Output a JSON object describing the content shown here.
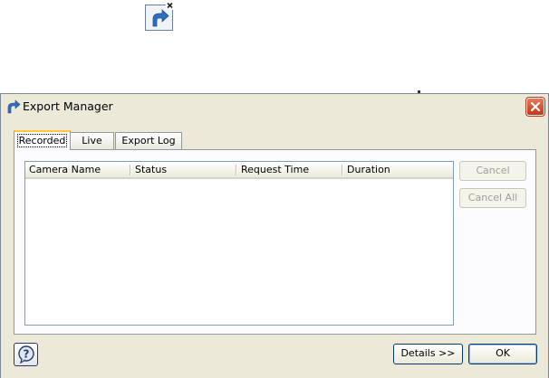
{
  "window": {
    "title": "Export Manager"
  },
  "tabs": [
    {
      "label": "Recorded",
      "active": true
    },
    {
      "label": "Live",
      "active": false
    },
    {
      "label": "Export Log",
      "active": false
    }
  ],
  "table": {
    "columns": [
      "Camera Name",
      "Status",
      "Request Time",
      "Duration"
    ],
    "rows": []
  },
  "buttons": {
    "cancel": "Cancel",
    "cancel_all": "Cancel All",
    "details": "Details >>",
    "ok": "OK"
  },
  "icons": {
    "floating": "export-shortcut-icon",
    "title": "export-arrow-icon",
    "close": "close-icon",
    "help": "help-icon"
  },
  "colors": {
    "window_bg": "#ece9d8",
    "close_red": "#c8361a",
    "tab_highlight": "#ffc83c",
    "arrow_blue": "#2f6fc0"
  }
}
